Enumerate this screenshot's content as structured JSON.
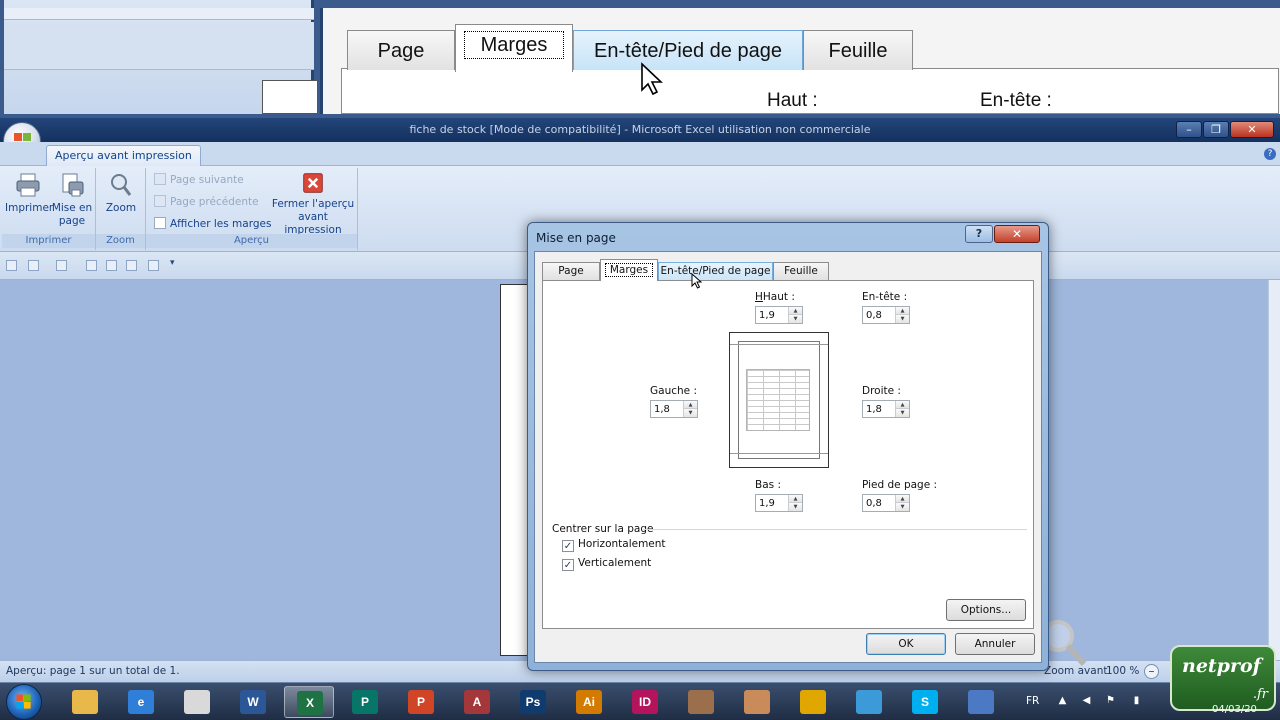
{
  "zoomed_view": {
    "tabs": [
      "Page",
      "Marges",
      "En-tête/Pied de page",
      "Feuille"
    ],
    "label_haut": "Haut :",
    "label_entete": "En-tête :"
  },
  "window": {
    "title": "fiche de stock  [Mode de compatibilité] - Microsoft Excel utilisation non commerciale",
    "min": "–",
    "max": "❐",
    "close": "✕"
  },
  "ribbon": {
    "tab": "Aperçu avant impression",
    "groups": {
      "imprimer": {
        "label": "Imprimer",
        "btn_imprimer": "Imprimer",
        "btn_mise_en_page_1": "Mise en",
        "btn_mise_en_page_2": "page"
      },
      "zoom": {
        "label": "Zoom",
        "btn_zoom": "Zoom"
      },
      "apercu": {
        "label": "Aperçu",
        "page_suivante": "Page suivante",
        "page_precedente": "Page précédente",
        "afficher_marges": "Afficher les marges",
        "fermer_1": "Fermer l'aperçu",
        "fermer_2": "avant impression"
      }
    }
  },
  "status": {
    "text": "Aperçu: page 1 sur un total de 1.",
    "zoom_avant": "Zoom avant",
    "zoom_level": "100 %"
  },
  "dialog": {
    "title": "Mise en page",
    "help": "?",
    "close": "✕",
    "tabs": [
      {
        "label": "Page",
        "active": false
      },
      {
        "label": "Marges",
        "active": true
      },
      {
        "label": "En-tête/Pied de page",
        "active": false
      },
      {
        "label": "Feuille",
        "active": false
      }
    ],
    "margins": {
      "haut": {
        "label": "Haut :",
        "value": "1,9"
      },
      "entete": {
        "label": "En-tête :",
        "value": "0,8"
      },
      "gauche": {
        "label": "Gauche :",
        "value": "1,8"
      },
      "droite": {
        "label": "Droite :",
        "value": "1,8"
      },
      "bas": {
        "label": "Bas :",
        "value": "1,9"
      },
      "pied": {
        "label": "Pied de page :",
        "value": "0,8"
      }
    },
    "center": {
      "label": "Centrer sur la page",
      "horizontal": {
        "label": "Horizontalement",
        "checked": true
      },
      "vertical": {
        "label": "Verticalement",
        "checked": true
      }
    },
    "options_button": "Options...",
    "ok_button": "OK",
    "cancel_button": "Annuler"
  },
  "taskbar": {
    "language": "FR",
    "date": "04/03/20",
    "apps": [
      {
        "name": "explorer",
        "label": "",
        "color": "#e8b84a"
      },
      {
        "name": "internet-explorer",
        "label": "e",
        "color": "#2f7ed8"
      },
      {
        "name": "clock",
        "label": "",
        "color": "#d9d9d9"
      },
      {
        "name": "word",
        "label": "W",
        "color": "#2b5797"
      },
      {
        "name": "excel",
        "label": "X",
        "color": "#1f7244"
      },
      {
        "name": "publisher",
        "label": "P",
        "color": "#077568"
      },
      {
        "name": "powerpoint",
        "label": "P",
        "color": "#d04525"
      },
      {
        "name": "access",
        "label": "A",
        "color": "#a4373a"
      },
      {
        "name": "photoshop",
        "label": "Ps",
        "color": "#0f3b6e"
      },
      {
        "name": "illustrator",
        "label": "Ai",
        "color": "#d37a00"
      },
      {
        "name": "indesign",
        "label": "ID",
        "color": "#b4145b"
      },
      {
        "name": "archive",
        "label": "",
        "color": "#9b6f4c"
      },
      {
        "name": "games",
        "label": "",
        "color": "#c98b5a"
      },
      {
        "name": "chrome",
        "label": "",
        "color": "#e0a700"
      },
      {
        "name": "messenger",
        "label": "",
        "color": "#3d9ad8"
      },
      {
        "name": "skype",
        "label": "S",
        "color": "#00aff0"
      },
      {
        "name": "remote",
        "label": "",
        "color": "#4b79c4"
      }
    ]
  },
  "watermark": {
    "text": "netprof",
    "suffix": ".fr"
  }
}
